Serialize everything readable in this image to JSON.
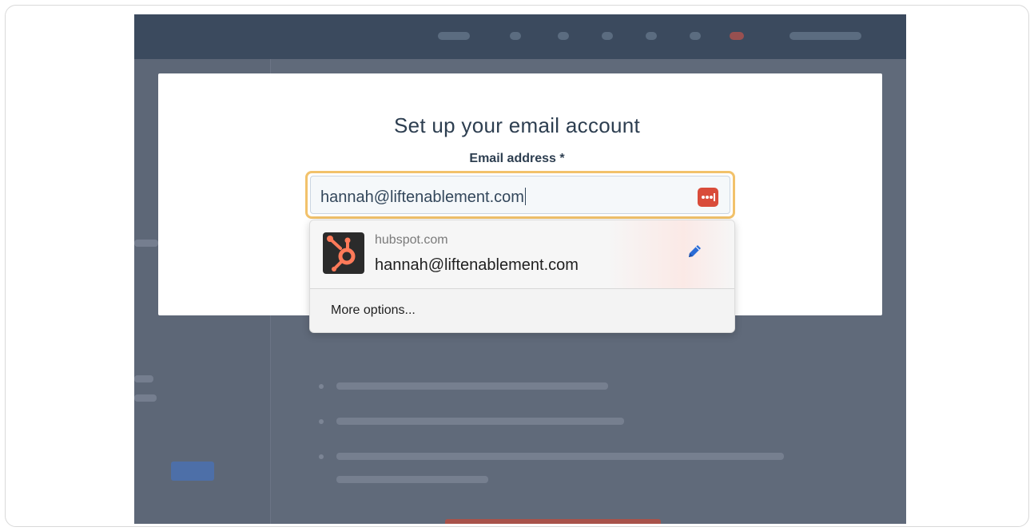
{
  "modal": {
    "title": "Set up your email account",
    "field_label": "Email address *"
  },
  "email_input": {
    "value": "hannah@liftenablement.com"
  },
  "autofill": {
    "suggestion": {
      "domain": "hubspot.com",
      "account": "hannah@liftenablement.com"
    },
    "more_options_label": "More options..."
  },
  "colors": {
    "focus_ring": "#f2c26b",
    "password_manager_icon": "#d94c3a",
    "hubspot_orange": "#ff7a59",
    "edit_icon_blue": "#2b6cd6",
    "overlay_bg": "#5b6575"
  },
  "icons": {
    "password_manager": "password-manager-icon",
    "site_logo": "hubspot-logo-icon",
    "edit": "pencil-icon"
  }
}
